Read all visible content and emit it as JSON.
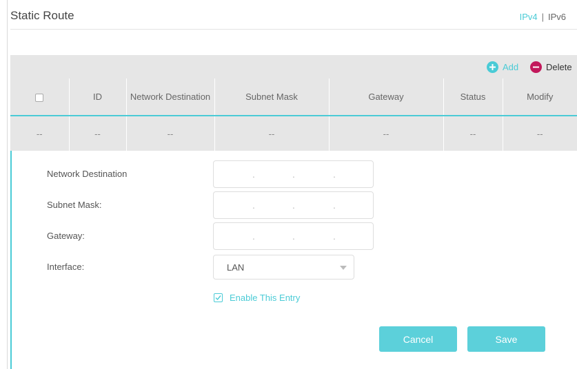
{
  "header": {
    "title": "Static Route",
    "ipv4_label": "IPv4",
    "separator": "|",
    "ipv6_label": "IPv6"
  },
  "toolbar": {
    "add_label": "Add",
    "delete_label": "Delete"
  },
  "table": {
    "columns": [
      "",
      "ID",
      "Network Destination",
      "Subnet Mask",
      "Gateway",
      "Status",
      "Modify"
    ],
    "row": [
      "--",
      "--",
      "--",
      "--",
      "--",
      "--",
      "--"
    ]
  },
  "form": {
    "network_destination_label": "Network Destination",
    "subnet_mask_label": "Subnet Mask:",
    "gateway_label": "Gateway:",
    "interface_label": "Interface:",
    "interface_value": "LAN",
    "enable_label": "Enable This Entry",
    "enable_checked": true,
    "ip_dot": "."
  },
  "buttons": {
    "cancel_label": "Cancel",
    "save_label": "Save"
  },
  "colors": {
    "accent": "#4acbd6",
    "delete": "#c2185b",
    "table_bg": "#e6e6e6"
  }
}
